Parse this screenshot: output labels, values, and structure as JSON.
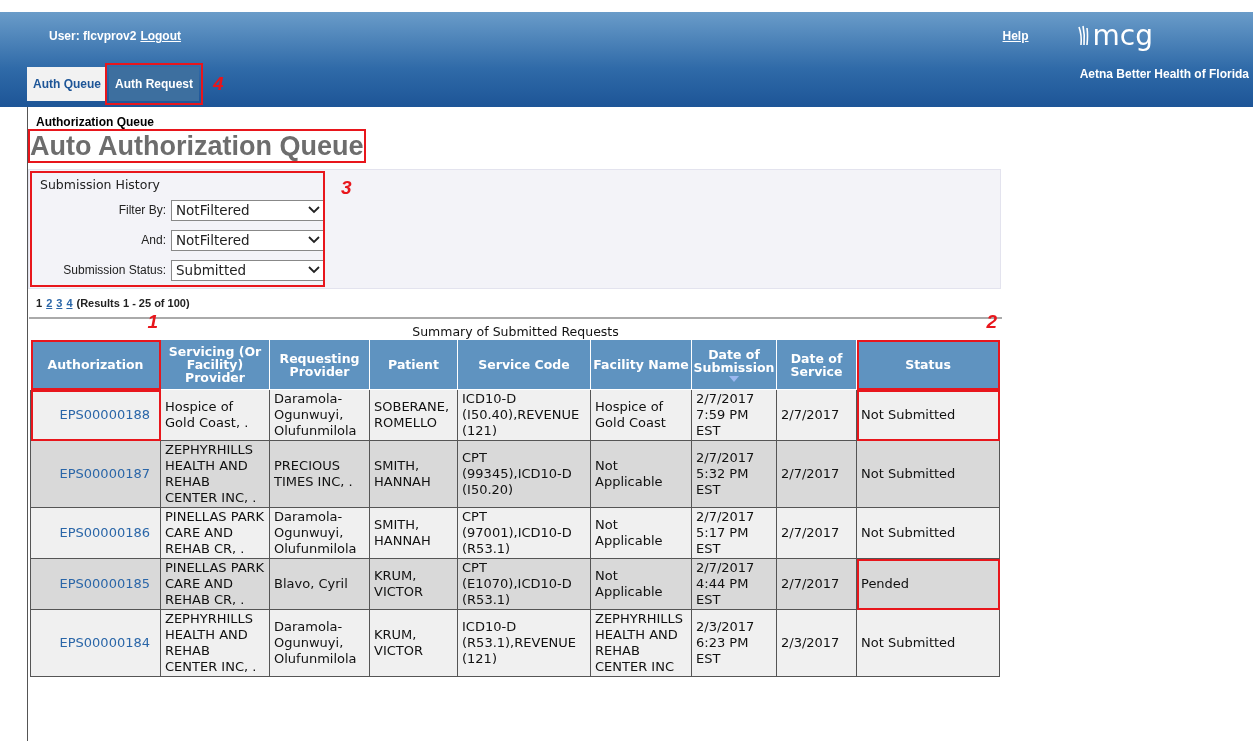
{
  "header": {
    "user_label": "User: flcvprov2",
    "logout": "Logout",
    "help": "Help",
    "logo": "mcg",
    "org": "Aetna Better Health of Florida"
  },
  "tabs": [
    {
      "label": "Auth Queue",
      "selected": true,
      "highlighted": false
    },
    {
      "label": "Auth Request",
      "selected": false,
      "highlighted": true,
      "callout": "4"
    }
  ],
  "breadcrumb": "Authorization Queue",
  "title": {
    "text": "Auto Authorization Queue",
    "highlighted": true
  },
  "filter_panel": {
    "heading": "Submission History",
    "highlighted": true,
    "callout": "3",
    "filters": [
      {
        "label": "Filter By:",
        "value": "NotFiltered"
      },
      {
        "label": "And:",
        "value": "NotFiltered"
      },
      {
        "label": "Submission Status:",
        "value": "Submitted"
      }
    ]
  },
  "pagination": {
    "pages": [
      {
        "label": "1",
        "selected": true
      },
      {
        "label": "2",
        "selected": false
      },
      {
        "label": "3",
        "selected": false
      },
      {
        "label": "4",
        "selected": false
      }
    ],
    "results": "(Results 1 - 25 of 100)"
  },
  "table": {
    "caption": "Summary of Submitted Requests",
    "columns": [
      {
        "label": "Authorization",
        "kind": "link",
        "highlighted": true,
        "callout": "1",
        "sorted": false
      },
      {
        "label": "Servicing (Or Facility) Provider",
        "kind": "text",
        "highlighted": false,
        "sorted": false
      },
      {
        "label": "Requesting Provider",
        "kind": "text",
        "highlighted": false,
        "sorted": false
      },
      {
        "label": "Patient",
        "kind": "text",
        "highlighted": false,
        "sorted": false
      },
      {
        "label": "Service Code",
        "kind": "text",
        "highlighted": false,
        "sorted": false
      },
      {
        "label": "Facility Name",
        "kind": "text",
        "highlighted": false,
        "sorted": false
      },
      {
        "label": "Date of Submission",
        "kind": "text",
        "highlighted": false,
        "sorted": true
      },
      {
        "label": "Date of Service",
        "kind": "text",
        "highlighted": false,
        "sorted": false
      },
      {
        "label": "Status",
        "kind": "text",
        "highlighted": true,
        "callout": "2",
        "sorted": false
      }
    ],
    "rows": [
      {
        "cells": [
          {
            "text": "EPS00000188",
            "highlighted": true
          },
          {
            "text": "Hospice of Gold Coast, .",
            "highlighted": false
          },
          {
            "text": "Daramola-Ogunwuyi, Olufunmilola",
            "highlighted": false
          },
          {
            "text": "SOBERANE, ROMELLO",
            "highlighted": false
          },
          {
            "text": "ICD10-D (I50.40),REVENUE (121)",
            "highlighted": false
          },
          {
            "text": "Hospice of Gold Coast",
            "highlighted": false
          },
          {
            "text": "2/7/2017 7:59 PM EST",
            "highlighted": false
          },
          {
            "text": "2/7/2017",
            "highlighted": false
          },
          {
            "text": "Not Submitted",
            "highlighted": true
          }
        ]
      },
      {
        "cells": [
          {
            "text": "EPS00000187",
            "highlighted": false
          },
          {
            "text": "ZEPHYRHILLS HEALTH AND REHAB CENTER INC, .",
            "highlighted": false
          },
          {
            "text": "PRECIOUS TIMES INC, .",
            "highlighted": false
          },
          {
            "text": "SMITH, HANNAH",
            "highlighted": false
          },
          {
            "text": "CPT (99345),ICD10-D (I50.20)",
            "highlighted": false
          },
          {
            "text": "Not Applicable",
            "highlighted": false
          },
          {
            "text": "2/7/2017 5:32 PM EST",
            "highlighted": false
          },
          {
            "text": "2/7/2017",
            "highlighted": false
          },
          {
            "text": "Not Submitted",
            "highlighted": false
          }
        ]
      },
      {
        "cells": [
          {
            "text": "EPS00000186",
            "highlighted": false
          },
          {
            "text": "PINELLAS PARK CARE AND REHAB CR, .",
            "highlighted": false
          },
          {
            "text": "Daramola-Ogunwuyi, Olufunmilola",
            "highlighted": false
          },
          {
            "text": "SMITH, HANNAH",
            "highlighted": false
          },
          {
            "text": "CPT (97001),ICD10-D (R53.1)",
            "highlighted": false
          },
          {
            "text": "Not Applicable",
            "highlighted": false
          },
          {
            "text": "2/7/2017 5:17 PM EST",
            "highlighted": false
          },
          {
            "text": "2/7/2017",
            "highlighted": false
          },
          {
            "text": "Not Submitted",
            "highlighted": false
          }
        ]
      },
      {
        "cells": [
          {
            "text": "EPS00000185",
            "highlighted": false
          },
          {
            "text": "PINELLAS PARK CARE AND REHAB CR, .",
            "highlighted": false
          },
          {
            "text": "Blavo, Cyril",
            "highlighted": false
          },
          {
            "text": "KRUM, VICTOR",
            "highlighted": false
          },
          {
            "text": "CPT (E1070),ICD10-D (R53.1)",
            "highlighted": false
          },
          {
            "text": "Not Applicable",
            "highlighted": false
          },
          {
            "text": "2/7/2017 4:44 PM EST",
            "highlighted": false
          },
          {
            "text": "2/7/2017",
            "highlighted": false
          },
          {
            "text": "Pended",
            "highlighted": true
          }
        ]
      },
      {
        "cells": [
          {
            "text": "EPS00000184",
            "highlighted": false
          },
          {
            "text": "ZEPHYRHILLS HEALTH AND REHAB CENTER INC, .",
            "highlighted": false
          },
          {
            "text": "Daramola-Ogunwuyi, Olufunmilola",
            "highlighted": false
          },
          {
            "text": "KRUM, VICTOR",
            "highlighted": false
          },
          {
            "text": "ICD10-D (R53.1),REVENUE (121)",
            "highlighted": false
          },
          {
            "text": "ZEPHYRHILLS HEALTH AND REHAB CENTER INC",
            "highlighted": false
          },
          {
            "text": "2/3/2017 6:23 PM EST",
            "highlighted": false
          },
          {
            "text": "2/3/2017",
            "highlighted": false
          },
          {
            "text": "Not Submitted",
            "highlighted": false
          }
        ]
      }
    ]
  }
}
